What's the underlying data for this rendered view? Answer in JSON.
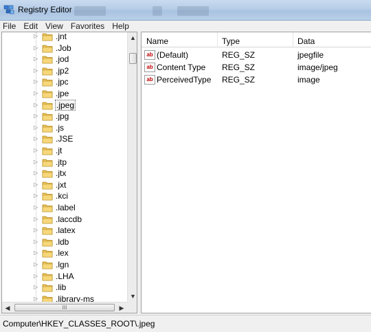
{
  "window": {
    "title": "Registry Editor"
  },
  "menu": [
    "File",
    "Edit",
    "View",
    "Favorites",
    "Help"
  ],
  "tree": {
    "items": [
      ".jnt",
      ".Job",
      ".jod",
      ".jp2",
      ".jpc",
      ".jpe",
      ".jpeg",
      ".jpg",
      ".js",
      ".JSE",
      ".jt",
      ".jtp",
      ".jtx",
      ".jxt",
      ".kci",
      ".label",
      ".laccdb",
      ".latex",
      ".ldb",
      ".lex",
      ".lgn",
      ".LHA",
      ".lib",
      ".library-ms"
    ],
    "selected": ".jpeg",
    "hscroll_grip": "III"
  },
  "values": {
    "columns": {
      "name": "Name",
      "type": "Type",
      "data": "Data"
    },
    "rows": [
      {
        "name": "(Default)",
        "type": "REG_SZ",
        "data": "jpegfile",
        "icon": "string-value-icon"
      },
      {
        "name": "Content Type",
        "type": "REG_SZ",
        "data": "image/jpeg",
        "icon": "string-value-icon"
      },
      {
        "name": "PerceivedType",
        "type": "REG_SZ",
        "data": "image",
        "icon": "string-value-icon"
      }
    ],
    "icon_text": "ab"
  },
  "status": {
    "path": "Computer\\HKEY_CLASSES_ROOT\\.jpeg"
  }
}
